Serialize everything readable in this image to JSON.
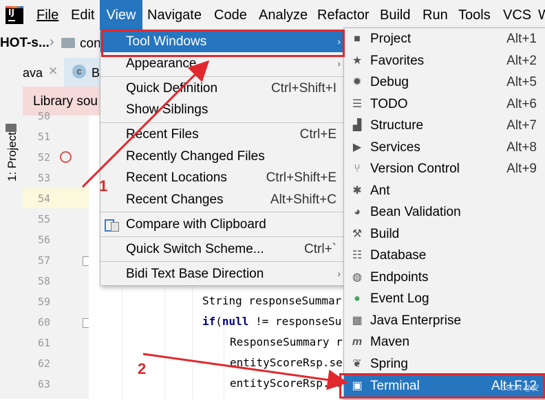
{
  "menubar": {
    "items": [
      "File",
      "Edit",
      "View",
      "Navigate",
      "Code",
      "Analyze",
      "Refactor",
      "Build",
      "Run",
      "Tools",
      "VCS",
      "W"
    ],
    "active": "View"
  },
  "breadcrumb": {
    "project": "HOT-s...",
    "folder": "con"
  },
  "left_strip": {
    "project_tab": "1: Project"
  },
  "editor_tabs": {
    "tab1": "ava",
    "tab2": "B"
  },
  "notice": {
    "text": "Library sou"
  },
  "gutter": {
    "line_numbers": [
      "50",
      "51",
      "52",
      "53",
      "54",
      "55",
      "56",
      "57",
      "58",
      "59",
      "60",
      "61",
      "62",
      "63"
    ]
  },
  "code": {
    "line59": "String responseSummar",
    "line60_kw1": "if",
    "line60_kw2": "null",
    "line60_rest": " != responseSu",
    "line60_open": "(",
    "line61": "ResponseSummary r",
    "line62": "entityScoreRsp.se",
    "line63": "entityScoreRsp.se"
  },
  "view_menu": {
    "items": [
      {
        "label": "Tool Windows",
        "shortcut": "",
        "submenu": true,
        "selected": true
      },
      {
        "label": "Appearance",
        "shortcut": "",
        "submenu": true
      },
      {
        "label": "Quick Definition",
        "shortcut": "Ctrl+Shift+I"
      },
      {
        "label": "Show Siblings",
        "shortcut": ""
      },
      {
        "label": "Recent Files",
        "shortcut": "Ctrl+E"
      },
      {
        "label": "Recently Changed Files",
        "shortcut": ""
      },
      {
        "label": "Recent Locations",
        "shortcut": "Ctrl+Shift+E"
      },
      {
        "label": "Recent Changes",
        "shortcut": "Alt+Shift+C"
      },
      {
        "label": "Compare with Clipboard",
        "shortcut": ""
      },
      {
        "label": "Quick Switch Scheme...",
        "shortcut": "Ctrl+`"
      },
      {
        "label": "Bidi Text Base Direction",
        "shortcut": "",
        "submenu": true
      }
    ]
  },
  "tool_windows_menu": {
    "items": [
      {
        "label": "Project",
        "shortcut": "Alt+1",
        "icon": "folder-icon"
      },
      {
        "label": "Favorites",
        "shortcut": "Alt+2",
        "icon": "star-icon"
      },
      {
        "label": "Debug",
        "shortcut": "Alt+5",
        "icon": "bug-icon"
      },
      {
        "label": "TODO",
        "shortcut": "Alt+6",
        "icon": "list-icon"
      },
      {
        "label": "Structure",
        "shortcut": "Alt+7",
        "icon": "structure-icon"
      },
      {
        "label": "Services",
        "shortcut": "Alt+8",
        "icon": "services-icon"
      },
      {
        "label": "Version Control",
        "shortcut": "Alt+9",
        "icon": "branch-icon"
      },
      {
        "label": "Ant",
        "shortcut": "",
        "icon": "ant-icon"
      },
      {
        "label": "Bean Validation",
        "shortcut": "",
        "icon": "bean-validation-icon"
      },
      {
        "label": "Build",
        "shortcut": "",
        "icon": "hammer-icon"
      },
      {
        "label": "Database",
        "shortcut": "",
        "icon": "database-icon"
      },
      {
        "label": "Endpoints",
        "shortcut": "",
        "icon": "globe-icon"
      },
      {
        "label": "Event Log",
        "shortcut": "",
        "icon": "event-log-icon"
      },
      {
        "label": "Java Enterprise",
        "shortcut": "",
        "icon": "java-enterprise-icon"
      },
      {
        "label": "Maven",
        "shortcut": "",
        "icon": "maven-icon"
      },
      {
        "label": "Spring",
        "shortcut": "",
        "icon": "spring-leaf-icon"
      },
      {
        "label": "Terminal",
        "shortcut": "Alt+F12",
        "icon": "terminal-icon",
        "selected": true
      }
    ]
  },
  "annotations": {
    "step1": "1",
    "step2": "2",
    "watermark": "CSDN @安"
  },
  "colors": {
    "accent": "#2675bf",
    "annotation_red": "#e0282d"
  }
}
